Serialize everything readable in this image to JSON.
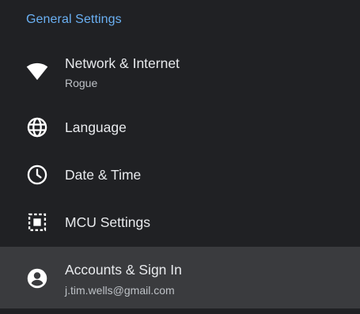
{
  "section": {
    "title": "General Settings"
  },
  "items": [
    {
      "id": "network",
      "icon": "wifi-icon",
      "label": "Network & Internet",
      "sublabel": "Rogue"
    },
    {
      "id": "language",
      "icon": "globe-icon",
      "label": "Language"
    },
    {
      "id": "datetime",
      "icon": "clock-icon",
      "label": "Date & Time"
    },
    {
      "id": "mcu",
      "icon": "mcu-chip-icon",
      "label": "MCU Settings"
    },
    {
      "id": "accounts",
      "icon": "account-circle-icon",
      "label": "Accounts & Sign In",
      "sublabel": "j.tim.wells@gmail.com",
      "focused": true
    }
  ],
  "colors": {
    "background": "#202124",
    "section_header": "#6ab0f3",
    "primary_text": "#e8eaed",
    "secondary_text": "#bdc1c6",
    "focused_row": "#3a3b3e"
  }
}
